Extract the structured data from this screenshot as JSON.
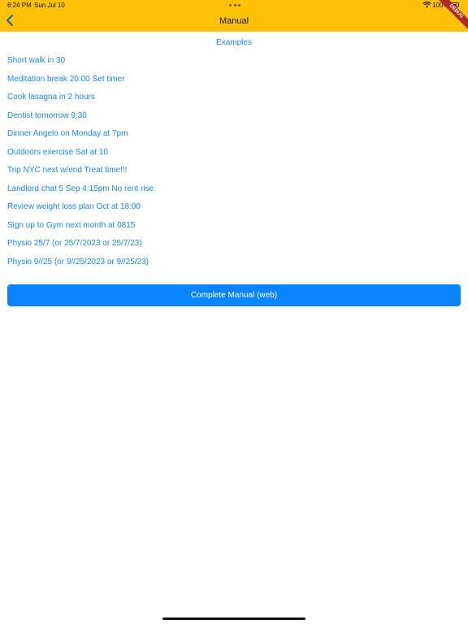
{
  "status_bar": {
    "time": "8:24 PM",
    "date": "Sun Jul 10",
    "battery": "100%"
  },
  "app_bar": {
    "title": "Manual",
    "debug_banner": "DEBUG"
  },
  "examples": {
    "title": "Examples",
    "items": [
      "Short walk in 30",
      "Meditation break 20:00 Set timer",
      "Cook lasagna in 2 hours",
      "Dentist tomorrow 9:30",
      "Dinner Angelo on Monday at 7pm",
      "Outdoors exercise Sat at 10",
      "Trip NYC next w/end Treat time!!!",
      "Landlord chat 5 Sep 4:15pm No rent rise",
      "Review weight loss plan Oct at 18:00",
      "Sign up to Gym next month at 0815",
      "Physio 25/7 (or 25/7/2023 or 25/7/23)",
      "Physio 9//25 (or 9//25/2023 or 9//25/23)"
    ]
  },
  "actions": {
    "complete_manual": "Complete Manual (web)"
  },
  "colors": {
    "app_bar": "#FFC107",
    "link": "#1E88E5",
    "primary_button": "#0A84FF"
  }
}
